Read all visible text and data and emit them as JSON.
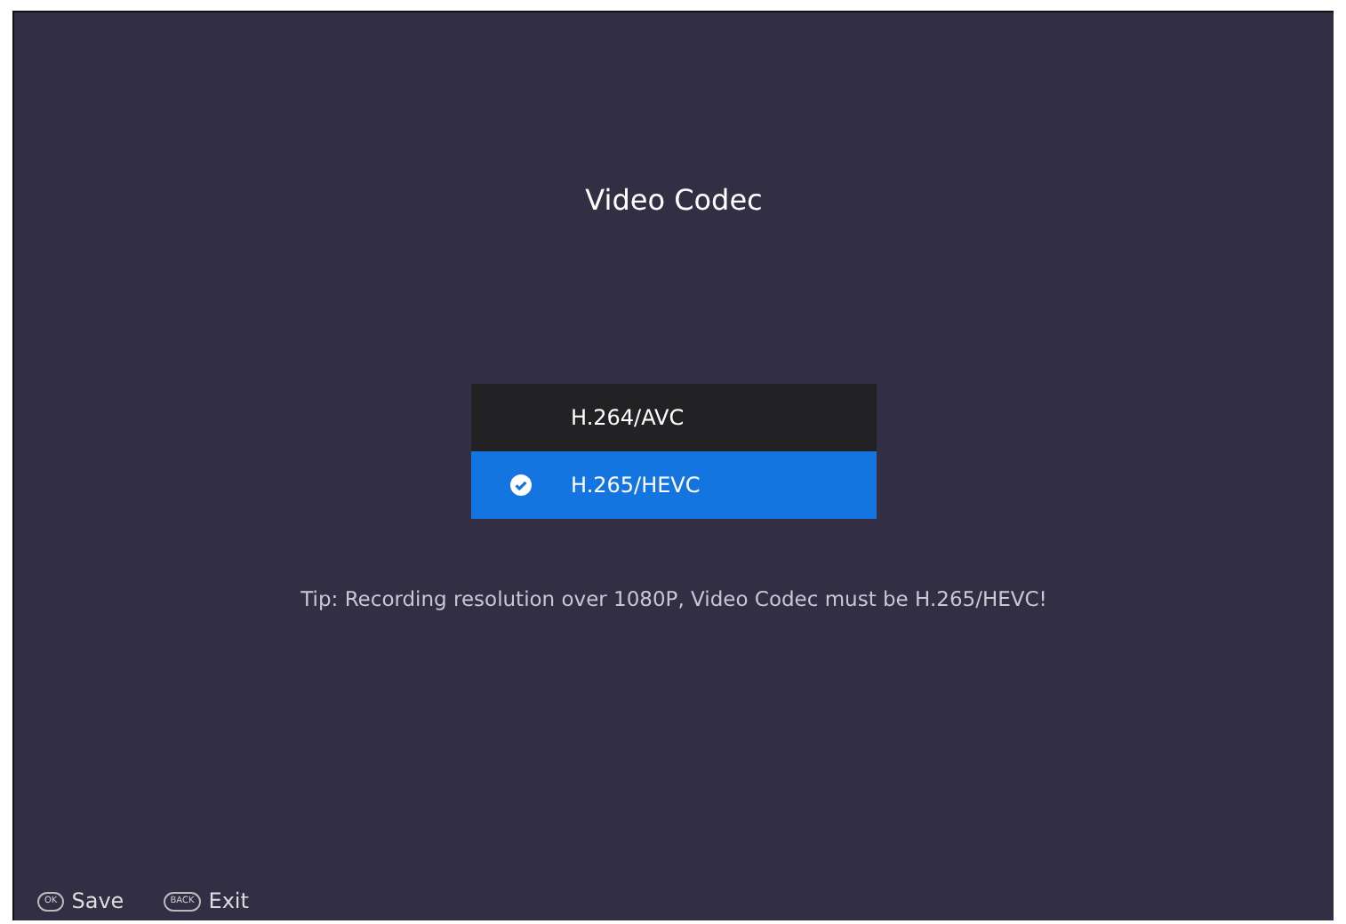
{
  "title": "Video Codec",
  "options": [
    {
      "label": "H.264/AVC",
      "selected": false
    },
    {
      "label": "H.265/HEVC",
      "selected": true
    }
  ],
  "tip": "Tip: Recording resolution over 1080P, Video Codec must be H.265/HEVC!",
  "footer": [
    {
      "key": "OK",
      "label": "Save"
    },
    {
      "key": "BACK",
      "label": "Exit"
    }
  ]
}
